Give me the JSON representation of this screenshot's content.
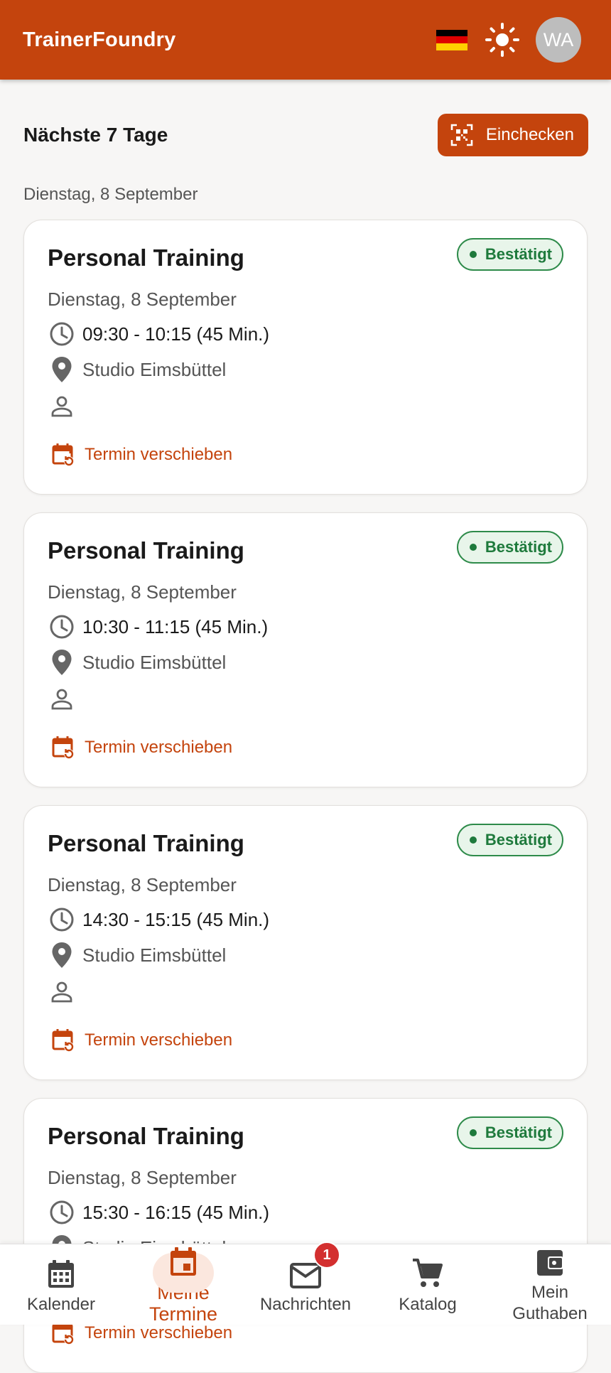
{
  "app": {
    "brand": "TrainerFoundry",
    "avatar_initials": "WA",
    "accent_color": "#c4440d",
    "flag_colors": [
      "#000000",
      "#dd0000",
      "#ffce00"
    ]
  },
  "header": {
    "title": "Nächste 7 Tage",
    "checkin_label": "Einchecken"
  },
  "day_group": {
    "label": "Dienstag, 8 September"
  },
  "appointments": [
    {
      "title": "Personal Training",
      "status": "Bestätigt",
      "date": "Dienstag, 8 September",
      "time": "09:30 - 10:15 (45 Min.)",
      "location": "Studio Eimsbüttel",
      "reschedule_label": "Termin verschieben"
    },
    {
      "title": "Personal Training",
      "status": "Bestätigt",
      "date": "Dienstag, 8 September",
      "time": "10:30 - 11:15 (45 Min.)",
      "location": "Studio Eimsbüttel",
      "reschedule_label": "Termin verschieben"
    },
    {
      "title": "Personal Training",
      "status": "Bestätigt",
      "date": "Dienstag, 8 September",
      "time": "14:30 - 15:15 (45 Min.)",
      "location": "Studio Eimsbüttel",
      "reschedule_label": "Termin verschieben"
    },
    {
      "title": "Personal Training",
      "status": "Bestätigt",
      "date": "Dienstag, 8 September",
      "time": "15:30 - 16:15 (45 Min.)",
      "location": "Studio Eimsbüttel",
      "reschedule_label": "Termin verschieben"
    }
  ],
  "nav": {
    "items": [
      {
        "label": "Kalender",
        "icon": "calendar-icon"
      },
      {
        "label": "Meine Termine",
        "icon": "event-icon",
        "active": true
      },
      {
        "label": "Nachrichten",
        "icon": "mail-icon",
        "badge": "1"
      },
      {
        "label": "Katalog",
        "icon": "cart-icon"
      },
      {
        "label": "Mein Guthaben",
        "icon": "wallet-icon"
      }
    ]
  }
}
